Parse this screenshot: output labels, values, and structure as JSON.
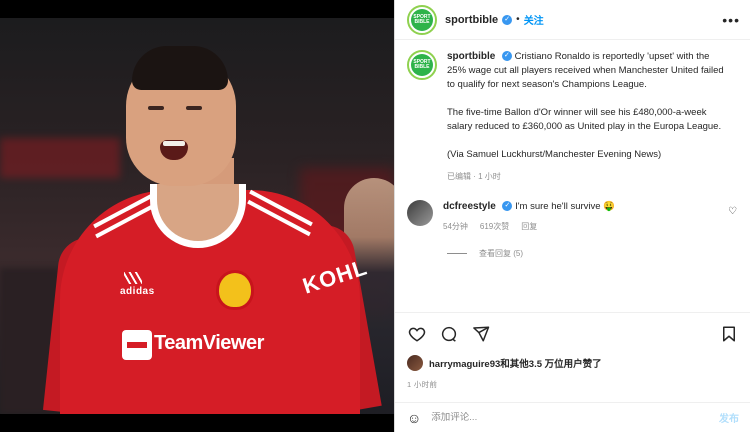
{
  "post": {
    "account": {
      "username": "sportbible",
      "avatar_text": "SPORT BIBLE",
      "verified": true,
      "follow_label": "关注",
      "separator": "•",
      "more_icon": "more-horizontal-icon"
    },
    "photo": {
      "sponsor_text": "TeamViewer",
      "kit_brand": "adidas",
      "kit_side_text": "KOHL"
    },
    "caption": {
      "username": "sportbible",
      "paragraphs": [
        "Cristiano Ronaldo is reportedly 'upset' with the 25% wage cut all players received when Manchester United failed to qualify for next season's Champions League.",
        "The five-time Ballon d'Or winner will see his £480,000-a-week salary reduced to £360,000 as United play in the Europa League.",
        "(Via Samuel Luckhurst/Manchester Evening News)"
      ],
      "meta": "已编辑 · 1 小时"
    },
    "comments": [
      {
        "username": "dcfreestyle",
        "verified": true,
        "text": "I'm sure he'll survive 🤑",
        "time": "54分钟",
        "likes": "619次赞",
        "reply_label": "回复"
      }
    ],
    "view_replies": "查看回复 (5)",
    "likes_text_user": "harrymaguire93",
    "likes_text_rest": "和其他3.5 万位用户赞了",
    "timestamp": "1 小时前",
    "add_comment": {
      "placeholder": "添加评论...",
      "post_label": "发布"
    }
  },
  "colors": {
    "accent": "#0095f6",
    "verified": "#3897f0",
    "muted": "#8e8e8e",
    "post_disabled": "#b2dffc"
  }
}
